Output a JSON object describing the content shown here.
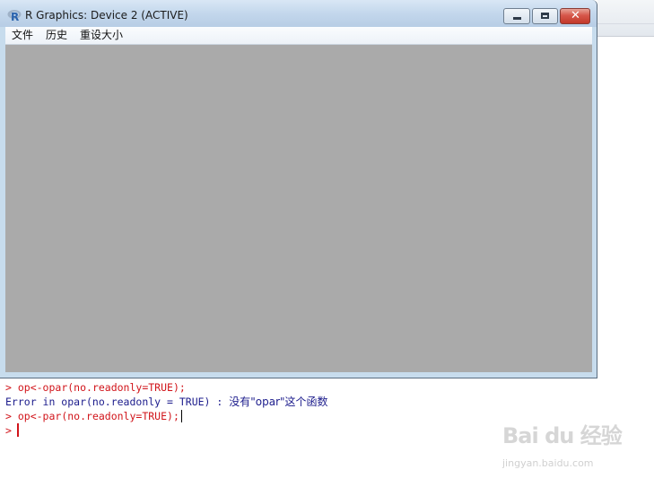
{
  "window": {
    "title": "R Graphics: Device 2 (ACTIVE)",
    "icon": "r-logo-icon",
    "controls": {
      "minimize": "minimize-icon",
      "maximize": "maximize-icon",
      "close": "close-icon"
    }
  },
  "menu": {
    "items": [
      "文件",
      "历史",
      "重设大小"
    ]
  },
  "canvas": {
    "background": "#aaaaaa"
  },
  "console": {
    "lines": [
      {
        "prompt": "> ",
        "text": "op<-opar(no.readonly=TRUE);"
      },
      {
        "text": "Error in opar(no.readonly = TRUE) : ",
        "message": "没有\"opar\"这个函数"
      },
      {
        "prompt": "> ",
        "text": "op<-par(no.readonly=TRUE);"
      },
      {
        "prompt": ">",
        "text": ""
      }
    ],
    "colors": {
      "input": "#d1141a",
      "error": "#1c1c8c"
    }
  },
  "watermark": {
    "logo": "Bai du 经验",
    "url": "jingyan.baidu.com"
  }
}
